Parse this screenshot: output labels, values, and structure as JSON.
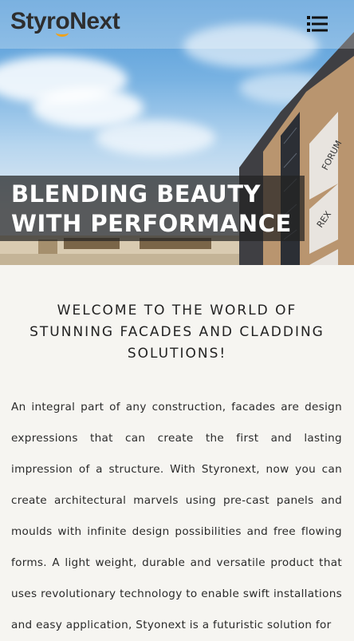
{
  "header": {
    "logo_prefix": "Styr",
    "logo_o": "o",
    "logo_suffix": "Next",
    "menu_icon": "hamburger-menu-icon"
  },
  "hero": {
    "headline_line1": "BLENDING BEAUTY",
    "headline_line2": "WITH PERFORMANCE",
    "sign1": "FORUM",
    "sign2": "REX"
  },
  "intro": {
    "heading": "WELCOME TO THE WORLD OF STUNNING FACADES AND CLADDING SOLUTIONS!",
    "paragraph": "An integral part of any construction, facades are design expressions that can create the first and lasting impression of a structure. With Styronext, now you can create architectural marvels using pre-cast panels and moulds with infinite design possibilities and free flowing forms. A light weight, durable and versatile product that uses revolutionary technology to enable swift installations and easy application, Styonext is a futuristic solution for"
  },
  "colors": {
    "brand_accent": "#f0a21a",
    "logo_text": "#2e2e2e",
    "page_background": "#f6f5f1"
  }
}
